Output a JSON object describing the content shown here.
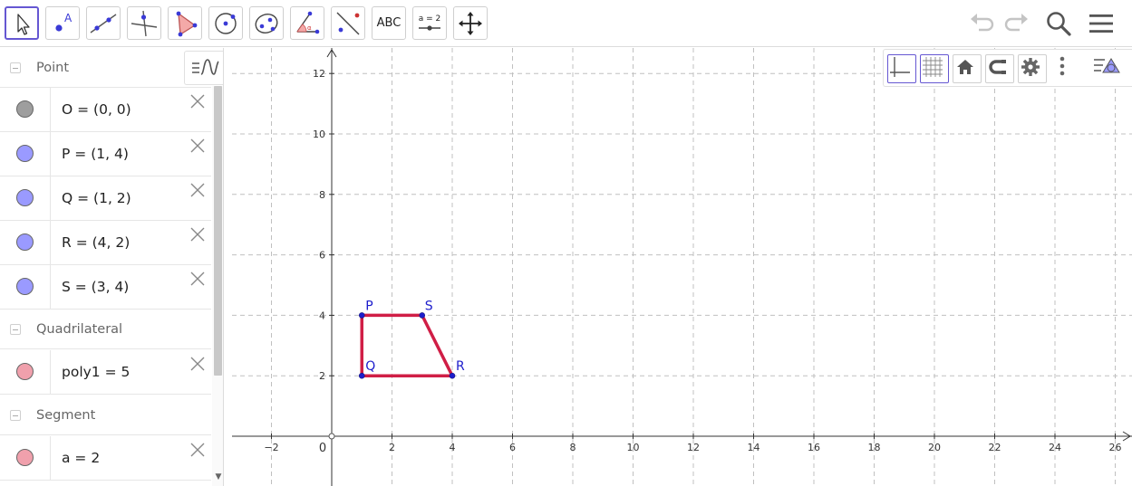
{
  "toolbar": {
    "tools": [
      {
        "id": "move",
        "icon": "cursor-arrow-icon"
      },
      {
        "id": "point",
        "icon": "point-icon"
      },
      {
        "id": "line",
        "icon": "line-through-points-icon"
      },
      {
        "id": "perpendicular",
        "icon": "perpendicular-line-icon"
      },
      {
        "id": "polygon",
        "icon": "polygon-icon"
      },
      {
        "id": "circle",
        "icon": "circle-center-point-icon"
      },
      {
        "id": "ellipse",
        "icon": "ellipse-icon"
      },
      {
        "id": "angle",
        "icon": "angle-icon"
      },
      {
        "id": "reflect",
        "icon": "reflect-about-line-icon"
      },
      {
        "id": "text",
        "icon": "text-tool-icon",
        "label": "ABC"
      },
      {
        "id": "slider",
        "icon": "slider-icon",
        "label": "a = 2"
      },
      {
        "id": "move-view",
        "icon": "move-graphics-view-icon"
      }
    ],
    "right": [
      "undo-icon",
      "redo-icon",
      "search-icon",
      "hamburger-menu-icon"
    ]
  },
  "algebra": {
    "categories": [
      {
        "label": "Point"
      },
      {
        "label": "Quadrilateral"
      },
      {
        "label": "Segment"
      }
    ],
    "rows": [
      {
        "formula": "O = (0, 0)",
        "color": "#9e9e9e"
      },
      {
        "formula": "P = (1, 4)",
        "color": "#9a9aff"
      },
      {
        "formula": "Q = (1, 2)",
        "color": "#9a9aff"
      },
      {
        "formula": "R = (4, 2)",
        "color": "#9a9aff"
      },
      {
        "formula": "S = (3, 4)",
        "color": "#9a9aff"
      },
      {
        "formula": "poly1 = 5",
        "color": "#f0a0ac"
      },
      {
        "formula": "a = 2",
        "color": "#f0a0ac"
      }
    ]
  },
  "graphics": {
    "x_ticks": [
      "−2",
      "0",
      "2",
      "4",
      "6",
      "8",
      "10",
      "12",
      "14",
      "16",
      "18",
      "20",
      "22",
      "24",
      "26"
    ],
    "y_ticks": [
      "2",
      "4",
      "6",
      "8",
      "10",
      "12"
    ],
    "origin_label": "0",
    "points": [
      {
        "name": "P",
        "x": 1,
        "y": 4
      },
      {
        "name": "Q",
        "x": 1,
        "y": 2
      },
      {
        "name": "R",
        "x": 4,
        "y": 2
      },
      {
        "name": "S",
        "x": 3,
        "y": 4
      }
    ],
    "polygon_color": "#d01e46",
    "point_color": "#1d1dcc",
    "grid": true,
    "style_bar": [
      "axes-toggle-icon",
      "grid-toggle-icon",
      "home-icon",
      "point-capturing-icon",
      "settings-gear-icon",
      "more-vertical-icon",
      "toggle-style-bar-icon"
    ]
  }
}
